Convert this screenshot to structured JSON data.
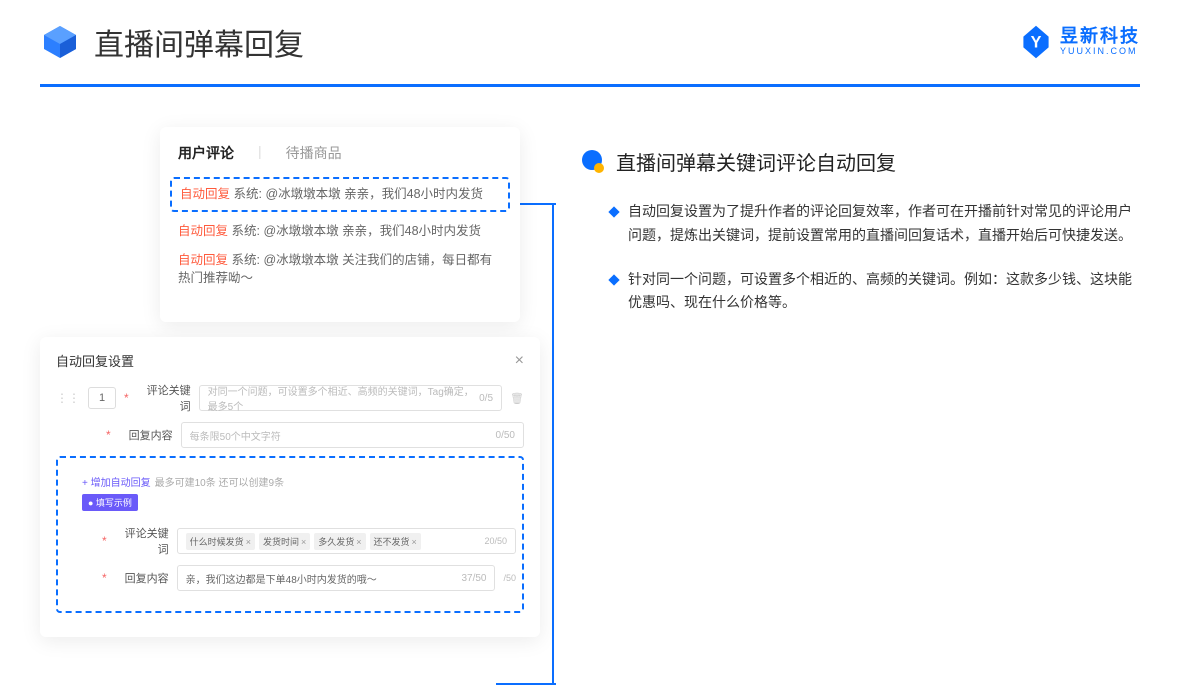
{
  "header": {
    "title": "直播间弹幕回复"
  },
  "brand": {
    "main": "昱新科技",
    "sub": "YUUXIN.COM"
  },
  "cardTop": {
    "tabs": {
      "active": "用户评论",
      "inactive": "待播商品"
    },
    "auto_label": "自动回复",
    "system_label": "系统:",
    "line1": "@冰墩墩本墩 亲亲，我们48小时内发货",
    "line2": "@冰墩墩本墩 亲亲，我们48小时内发货",
    "line3": "@冰墩墩本墩 关注我们的店铺，每日都有热门推荐呦～"
  },
  "panel": {
    "title": "自动回复设置",
    "num": "1",
    "kw_label": "评论关键词",
    "kw_placeholder": "对同一个问题，可设置多个相近、高频的关键词，Tag确定，最多5个",
    "kw_counter": "0/5",
    "reply_label": "回复内容",
    "reply_placeholder": "每条限50个中文字符",
    "reply_counter": "0/50",
    "add_text": "+ 增加自动回复",
    "add_hint": "最多可建10条 还可以创建9条",
    "example_badge": "● 填写示例",
    "ex_kw_label": "评论关键词",
    "ex_tags": [
      "什么时候发货",
      "发货时间",
      "多久发货",
      "还不发货"
    ],
    "ex_kw_counter": "20/50",
    "ex_reply_label": "回复内容",
    "ex_reply_value": "亲，我们这边都是下单48小时内发货的哦～",
    "ex_reply_counter": "37/50",
    "stray_counter": "/50"
  },
  "right": {
    "section_title": "直播间弹幕关键词评论自动回复",
    "b1": "自动回复设置为了提升作者的评论回复效率，作者可在开播前针对常见的评论用户问题，提炼出关键词，提前设置常用的直播间回复话术，直播开始后可快捷发送。",
    "b2": "针对同一个问题，可设置多个相近的、高频的关键词。例如：这款多少钱、这块能优惠吗、现在什么价格等。"
  }
}
